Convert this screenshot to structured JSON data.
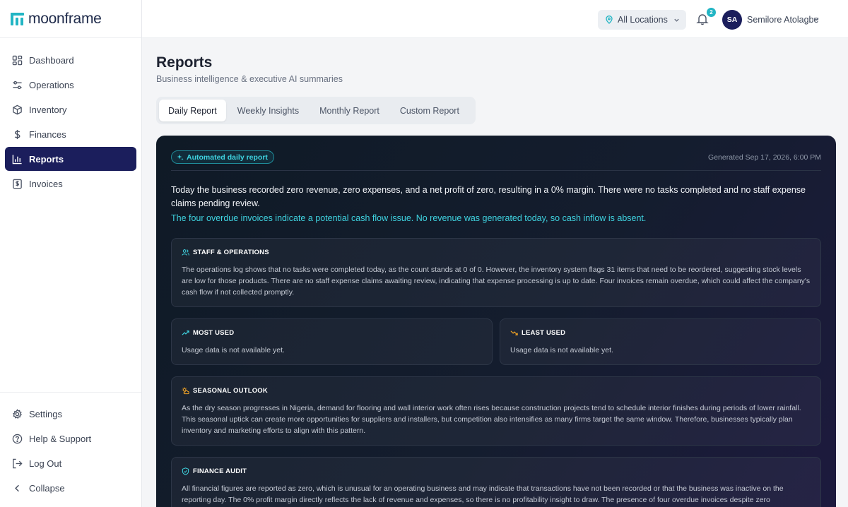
{
  "brand": {
    "name": "moonframe"
  },
  "sidebar": {
    "items": [
      {
        "label": "Dashboard",
        "icon": "dashboard-icon"
      },
      {
        "label": "Operations",
        "icon": "sliders-icon"
      },
      {
        "label": "Inventory",
        "icon": "box-icon"
      },
      {
        "label": "Finances",
        "icon": "dollar-icon"
      },
      {
        "label": "Reports",
        "icon": "bar-chart-icon",
        "active": true
      },
      {
        "label": "Invoices",
        "icon": "invoice-icon"
      }
    ],
    "bottom_items": [
      {
        "label": "Settings",
        "icon": "gear-icon"
      },
      {
        "label": "Help & Support",
        "icon": "help-icon"
      },
      {
        "label": "Log Out",
        "icon": "logout-icon"
      },
      {
        "label": "Collapse",
        "icon": "chevron-left-icon"
      }
    ]
  },
  "topbar": {
    "location": "All Locations",
    "notifications_count": "2",
    "user_initials": "SA",
    "user_name": "Semilore Atolagbe"
  },
  "page": {
    "title": "Reports",
    "subtitle": "Business intelligence & executive AI summaries"
  },
  "tabs": [
    {
      "label": "Daily Report",
      "active": true
    },
    {
      "label": "Weekly Insights"
    },
    {
      "label": "Monthly Report"
    },
    {
      "label": "Custom Report"
    }
  ],
  "report": {
    "badge": "Automated daily report",
    "generated": "Generated Sep 17, 2026, 6:00 PM",
    "summary": "Today the business recorded zero revenue, zero expenses, and a net profit of zero, resulting in a 0% margin. There were no tasks completed and no staff expense claims pending review.",
    "insight": "The four overdue invoices indicate a potential cash flow issue. No revenue was generated today, so cash inflow is absent.",
    "staff": {
      "title": "STAFF & OPERATIONS",
      "body": "The operations log shows that no tasks were completed today, as the count stands at 0 of 0. However, the inventory system flags 31 items that need to be reordered, suggesting stock levels are low for those products. There are no staff expense claims awaiting review, indicating that expense processing is up to date. Four invoices remain overdue, which could affect the company's cash flow if not collected promptly."
    },
    "most_used": {
      "title": "MOST USED",
      "body": "Usage data is not available yet."
    },
    "least_used": {
      "title": "LEAST USED",
      "body": "Usage data is not available yet."
    },
    "seasonal": {
      "title": "SEASONAL OUTLOOK",
      "body": "As the dry season progresses in Nigeria, demand for flooring and wall interior work often rises because construction projects tend to schedule interior finishes during periods of lower rainfall. This seasonal uptick can create more opportunities for suppliers and installers, but competition also intensifies as many firms target the same window. Therefore, businesses typically plan inventory and marketing efforts to align with this pattern."
    },
    "audit": {
      "title": "FINANCE AUDIT",
      "body": "All financial figures are reported as zero, which is unusual for an operating business and may indicate that transactions have not been recorded or that the business was inactive on the reporting day. The 0% profit margin directly reflects the lack of revenue and expenses, so there is no profitability insight to draw. The presence of four overdue invoices despite zero"
    }
  },
  "colors": {
    "accent": "#22b5c4",
    "nav_active": "#1b1e5c",
    "report_bg": "#121b2b",
    "most_used_icon": "#3fd3e0",
    "least_used_icon": "#f5a524"
  }
}
